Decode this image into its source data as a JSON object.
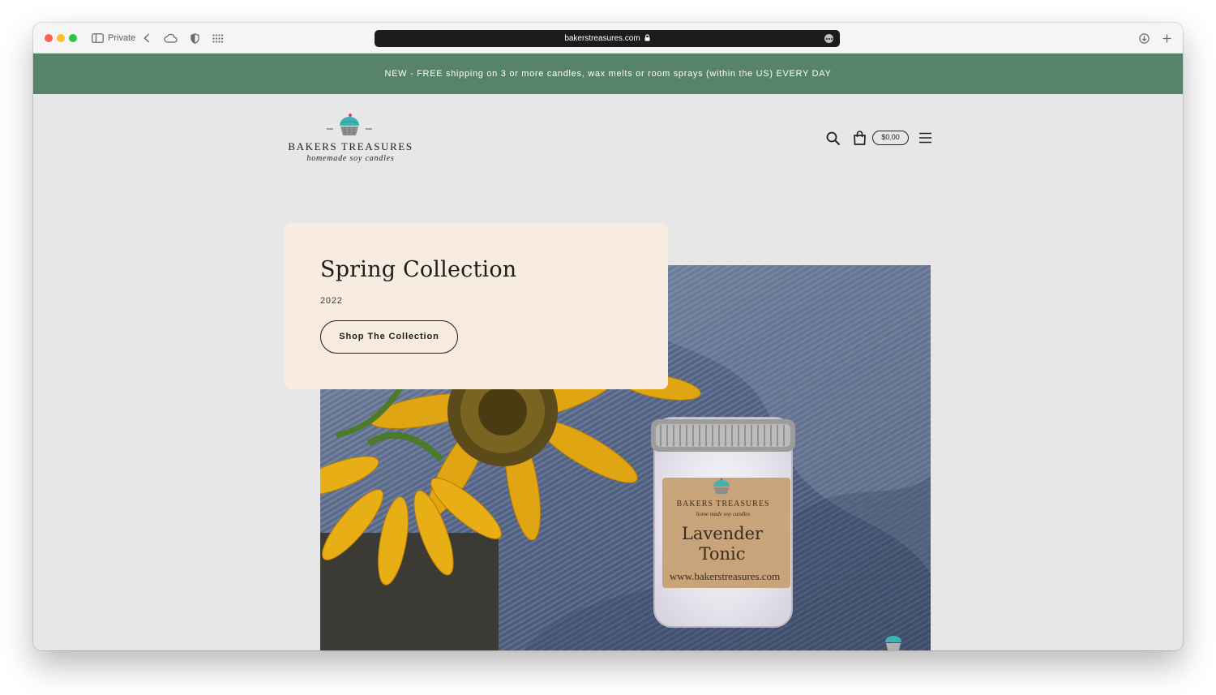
{
  "browser": {
    "private_label": "Private",
    "url": "bakerstreasures.com"
  },
  "announcement": {
    "text": "NEW - FREE shipping on 3 or more candles, wax melts or room sprays (within the US) EVERY DAY"
  },
  "header": {
    "logo_brand": "BAKERS TREASURES",
    "logo_tagline": "homemade soy candles",
    "cart_total": "$0.00",
    "icons": [
      "search-icon",
      "cart-icon",
      "menu-icon"
    ]
  },
  "hero": {
    "title": "Spring Collection",
    "year": "2022",
    "button_label": "Shop The Collection",
    "image_label": {
      "brand": "BAKERS TREASURES",
      "tagline": "home made soy candles",
      "product_line1": "Lavender",
      "product_line2": "Tonic",
      "website": "www.bakerstreasures.com"
    }
  },
  "colors": {
    "announcement_bg": "#568369",
    "page_bg": "#e7e7e7",
    "card_bg": "#f8ece1",
    "cupcake_frosting": "#3fb3b3"
  }
}
